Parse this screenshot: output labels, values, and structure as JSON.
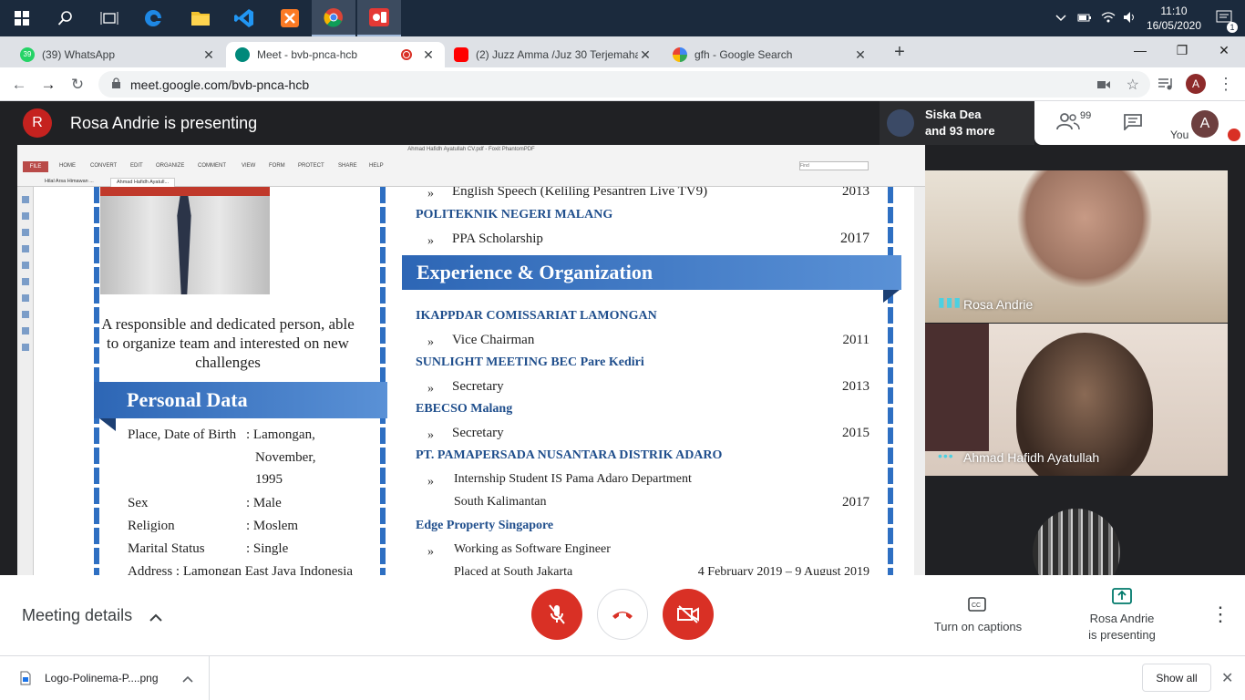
{
  "taskbar": {
    "time": "11:10",
    "date": "16/05/2020",
    "notification_count": "1"
  },
  "tabs": [
    {
      "label": "(39) WhatsApp",
      "color": "#25d366"
    },
    {
      "label": "Meet - bvb-pnca-hcb",
      "color": "#00897b"
    },
    {
      "label": "(2) Juzz Amma /Juz 30 Terjemaha",
      "color": "#ff0000"
    },
    {
      "label": "gfh - Google Search",
      "color": "#4285f4"
    }
  ],
  "address_bar": {
    "url": "meet.google.com/bvb-pnca-hcb",
    "profile_initial": "A"
  },
  "meet": {
    "presenter_initial": "R",
    "presenter_title": "Rosa Andrie is presenting",
    "people_name": "Siska Dea",
    "people_more": "and 93 more",
    "participant_count": "99",
    "you_label": "You",
    "you_initial": "A",
    "tiles": [
      {
        "name": "Rosa Andrie"
      },
      {
        "name": "Ahmad Hafidh Ayatullah"
      }
    ]
  },
  "pdf": {
    "window_title": "Ahmad Hafidh Ayatullah CV.pdf - Foxit PhantomPDF",
    "file_button": "FILE",
    "menu": [
      "HOME",
      "CONVERT",
      "EDIT",
      "ORGANIZE",
      "COMMENT",
      "VIEW",
      "FORM",
      "PROTECT",
      "SHARE",
      "HELP"
    ],
    "search_placeholder": "Find",
    "doc_tabs": [
      "Hilal Arsa Himawan ...",
      "Ahmad Hafidh Ayatull..."
    ]
  },
  "cv": {
    "summary": "A responsible and dedicated person, able to organize team and interested on new challenges",
    "personal_data_title": "Personal Data",
    "personal_data": [
      {
        "label": "Place, Date of Birth",
        "value": ": Lamongan,"
      },
      {
        "label": "",
        "value": "November,"
      },
      {
        "label": "",
        "value": "1995"
      },
      {
        "label": "Sex",
        "value": ": Male"
      },
      {
        "label": "Religion",
        "value": ": Moslem"
      },
      {
        "label": "Marital Status",
        "value": ": Single"
      },
      {
        "label": "Address : Lamongan East Java Indonesia",
        "value": ""
      }
    ],
    "top_entries": [
      {
        "role": "English Speech  (Keliling Pesantren Live TV9)",
        "year": "2013"
      },
      {
        "org": "POLITEKNIK NEGERI MALANG"
      },
      {
        "role": "PPA Scholarship",
        "year": "2017"
      }
    ],
    "experience_title": "Experience & Organization",
    "experience": [
      {
        "org": "IKAPPDAR COMISSARIAT LAMONGAN",
        "role": "Vice Chairman",
        "year": "2011"
      },
      {
        "org": "SUNLIGHT MEETING BEC Pare Kediri",
        "role": "Secretary",
        "year": "2013"
      },
      {
        "org": "EBECSO Malang",
        "role": "Secretary",
        "year": "2015"
      },
      {
        "org": "PT. PAMAPERSADA NUSANTARA DISTRIK ADARO",
        "role": "Internship Student IS Pama Adaro Department",
        "role2": "South Kalimantan",
        "year": "2017"
      },
      {
        "org": "Edge Property Singapore",
        "role": "Working as Software Engineer",
        "role2": "Placed at South Jakarta",
        "year": "4 February 2019 – 9 August 2019"
      }
    ]
  },
  "controls": {
    "meeting_details": "Meeting details",
    "captions": "Turn on captions",
    "presenting_line1": "Rosa Andrie",
    "presenting_line2": "is presenting"
  },
  "downloads": {
    "file_name": "Logo-Polinema-P....png",
    "show_all": "Show all"
  }
}
